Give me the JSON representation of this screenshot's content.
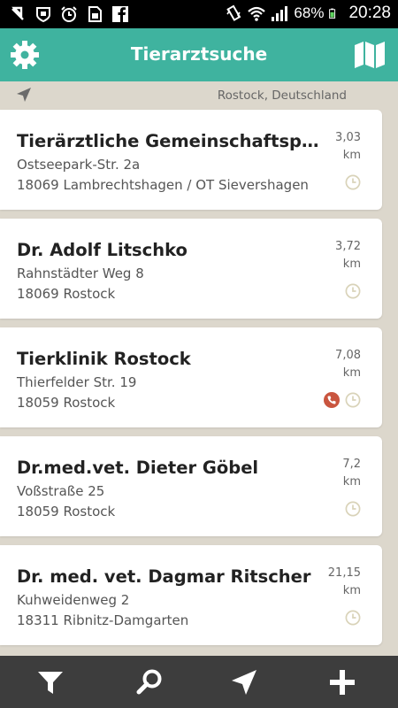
{
  "status_bar": {
    "battery_percent": "68%",
    "time": "20:28",
    "icons": [
      "no-mail-icon",
      "shield-icon",
      "alarm-icon",
      "sim-icon",
      "facebook-icon",
      "vibrate-icon",
      "wifi-icon",
      "signal-icon",
      "battery-icon"
    ]
  },
  "app_bar": {
    "title": "Tierarztsuche",
    "left_icon": "gear-icon",
    "right_icon": "map-icon",
    "accent_color": "#3fb39f"
  },
  "location": {
    "text": "Rostock, Deutschland",
    "icon": "location-arrow-icon"
  },
  "results": [
    {
      "name": "Tierärztliche Gemeinschaftspr…",
      "street": "Ostseepark-Str. 2a",
      "city": "18069 Lambrechtshagen / OT Sievershagen",
      "distance": "3,03",
      "unit": "km",
      "emergency": false
    },
    {
      "name": "Dr. Adolf Litschko",
      "street": "Rahnstädter Weg 8",
      "city": "18069 Rostock",
      "distance": "3,72",
      "unit": "km",
      "emergency": false
    },
    {
      "name": "Tierklinik Rostock",
      "street": "Thierfelder Str. 19",
      "city": "18059 Rostock",
      "distance": "7,08",
      "unit": "km",
      "emergency": true
    },
    {
      "name": "Dr.med.vet. Dieter Göbel",
      "street": "Voßstraße 25",
      "city": "18059 Rostock",
      "distance": "7,2",
      "unit": "km",
      "emergency": false
    },
    {
      "name": "Dr. med. vet. Dagmar Ritscher",
      "street": "Kuhweidenweg 2",
      "city": "18311 Ribnitz-Damgarten",
      "distance": "21,15",
      "unit": "km",
      "emergency": false
    }
  ],
  "bottom_bar": {
    "buttons": [
      "filter-icon",
      "search-icon",
      "navigate-icon",
      "add-icon"
    ]
  }
}
